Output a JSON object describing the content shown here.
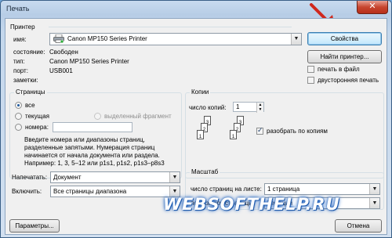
{
  "window": {
    "title": "Печать",
    "close_glyph": "✕"
  },
  "printer": {
    "group_title": "Принтер",
    "name_label": "имя:",
    "name_value": "Canon MP150 Series Printer",
    "status_label": "состояние:",
    "status_value": "Свободен",
    "type_label": "тип:",
    "type_value": "Canon MP150 Series Printer",
    "port_label": "порт:",
    "port_value": "USB001",
    "notes_label": "заметки:",
    "properties_button": "Свойства",
    "find_printer_button": "Найти принтер...",
    "print_to_file_label": "печать в файл",
    "print_to_file_checked": false,
    "duplex_label": "двусторонняя печать",
    "duplex_checked": false
  },
  "pages": {
    "group_title": "Страницы",
    "all_label": "все",
    "current_label": "текущая",
    "selection_label": "выделенный фрагмент",
    "numbers_label": "номера:",
    "selected": "all",
    "numbers_value": "",
    "hint": [
      "Введите номера или диапазоны страниц,",
      "разделенные запятыми. Нумерация страниц",
      "начинается от начала документа или раздела.",
      "Например: 1, 3, 5–12 или p1s1, p1s2, p1s3–p8s3"
    ]
  },
  "copies": {
    "group_title": "Копии",
    "count_label": "число копий:",
    "count_value": "1",
    "collate_label": "разобрать по копиям",
    "collate_checked": true,
    "page_labels": [
      "3",
      "2",
      "1",
      "3",
      "2",
      "1"
    ]
  },
  "print_what": {
    "label": "Напечатать:",
    "value": "Документ"
  },
  "include": {
    "label": "Включить:",
    "value": "Все страницы диапазона"
  },
  "zoom": {
    "group_title": "Масштаб",
    "pages_per_sheet_label": "число страниц на листе:",
    "pages_per_sheet_value": "1 страница",
    "scale_to_paper_label": "по размеру страницы:",
    "scale_to_paper_value": "Текущий"
  },
  "footer": {
    "options_button": "Параметры...",
    "cancel_button": "Отмена"
  },
  "watermark": "WEBSOFTHELP.RU",
  "colors": {
    "annotation_arrow": "#d0281d",
    "watermark_glow": "#2a6ed0"
  }
}
